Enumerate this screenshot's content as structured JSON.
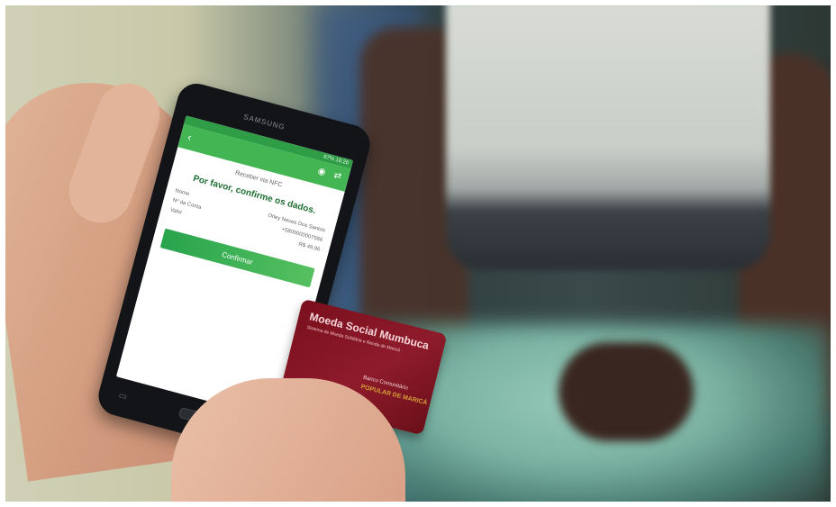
{
  "phone": {
    "brand": "SAMSUNG",
    "status_bar": "67% 16:26",
    "screen": {
      "subtitle": "Receber via NFC",
      "title": "Por favor, confirme os dados.",
      "details": [
        {
          "label": "Nome",
          "value": "Orley Neves Dos Santos"
        },
        {
          "label": "Nº da Conta",
          "value": "+5800000007586"
        },
        {
          "label": "Valor",
          "value": "R$ 49,96"
        }
      ],
      "confirm_label": "Confirmar"
    }
  },
  "card": {
    "title": "Moeda Social Mumbuca",
    "subtitle": "Sistema de Moeda Solidária e Renda de Maricá",
    "bank_line_1": "Banco Comunitário",
    "bank_line_2": "POPULAR DE MARICÁ"
  }
}
